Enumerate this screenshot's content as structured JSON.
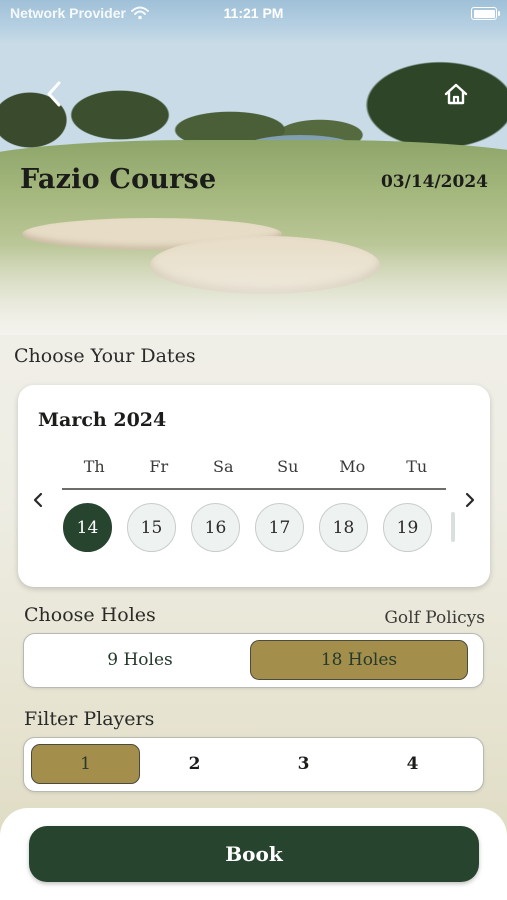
{
  "status_bar": {
    "provider": "Network Provider",
    "time": "11:21 PM",
    "wifi_icon": "wifi-icon",
    "battery_icon": "battery-icon"
  },
  "header": {
    "back_icon": "chevron-left-icon",
    "home_icon": "home-icon",
    "course_name": "Fazio Course",
    "date": "03/14/2024"
  },
  "dates": {
    "heading": "Choose Your Dates",
    "month": "March 2024",
    "weekdays": [
      "Th",
      "Fr",
      "Sa",
      "Su",
      "Mo",
      "Tu"
    ],
    "days": [
      "14",
      "15",
      "16",
      "17",
      "18",
      "19"
    ],
    "selected_day": "14",
    "prev_icon": "chevron-left-icon",
    "next_icon": "chevron-right-icon"
  },
  "holes": {
    "heading": "Choose Holes",
    "policy_link": "Golf Policys",
    "options": [
      "9 Holes",
      "18 Holes"
    ],
    "selected": "18 Holes"
  },
  "players": {
    "heading": "Filter Players",
    "options": [
      "1",
      "2",
      "3",
      "4"
    ],
    "selected": "1"
  },
  "book_label": "Book",
  "colors": {
    "primary_green": "#27442f",
    "gold": "#a38e4c",
    "day_bg": "#eef2f1"
  }
}
